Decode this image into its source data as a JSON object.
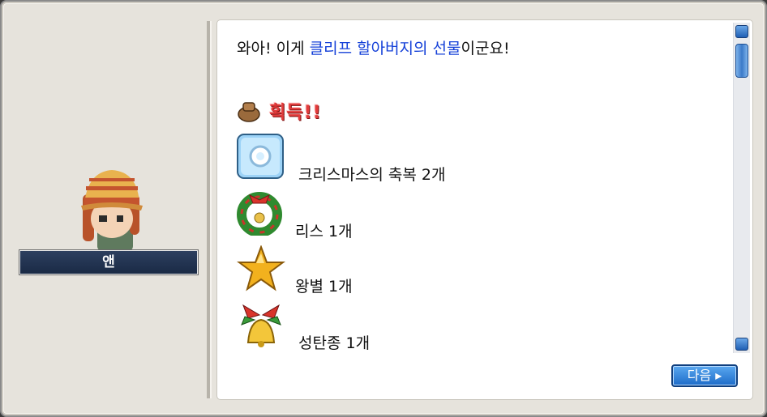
{
  "npc": {
    "name": "앤"
  },
  "dialog": {
    "prefix": "와아! 이게 ",
    "highlight": "클리프 할아버지의 선물",
    "suffix": "이군요!"
  },
  "reward": {
    "label": "획득!!",
    "icon": "bag-icon"
  },
  "items": [
    {
      "name": "크리스마스의 축복 2개",
      "icon": "christmas-blessing-icon"
    },
    {
      "name": "리스 1개",
      "icon": "wreath-icon"
    },
    {
      "name": "왕별 1개",
      "icon": "star-icon"
    },
    {
      "name": "성탄종 1개",
      "icon": "bell-icon"
    }
  ],
  "buttons": {
    "next": "다음 ▸"
  },
  "colors": {
    "highlight": "#1440d8",
    "reward": "#e23b3b",
    "namebar": "#1a2a45"
  }
}
